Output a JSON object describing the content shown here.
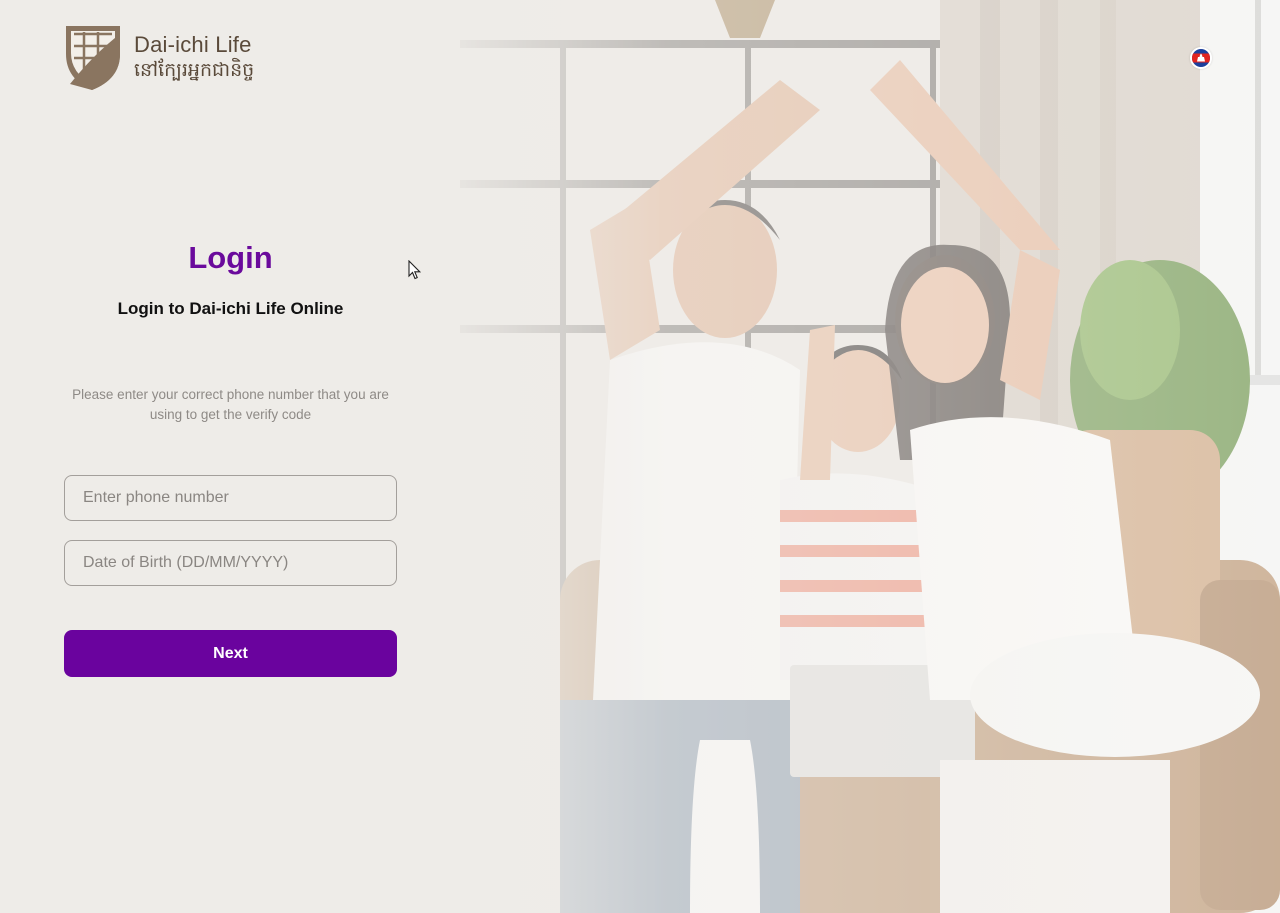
{
  "brand": {
    "name_en": "Dai-ichi Life",
    "name_kh": "នៅក្បែរអ្នកជានិច្ច"
  },
  "language": {
    "icon": "cambodia-flag-icon"
  },
  "login": {
    "title": "Login",
    "subtitle": "Login to Dai-ichi Life Online",
    "helper_text": "Please enter your correct phone number that you are using to get the verify code",
    "phone_placeholder": "Enter phone number",
    "dob_placeholder": "Date of Birth (DD/MM/YYYY)",
    "next_label": "Next"
  },
  "colors": {
    "accent": "#6a039e",
    "title": "#6a0a9c",
    "brand_brown": "#8a7560"
  }
}
